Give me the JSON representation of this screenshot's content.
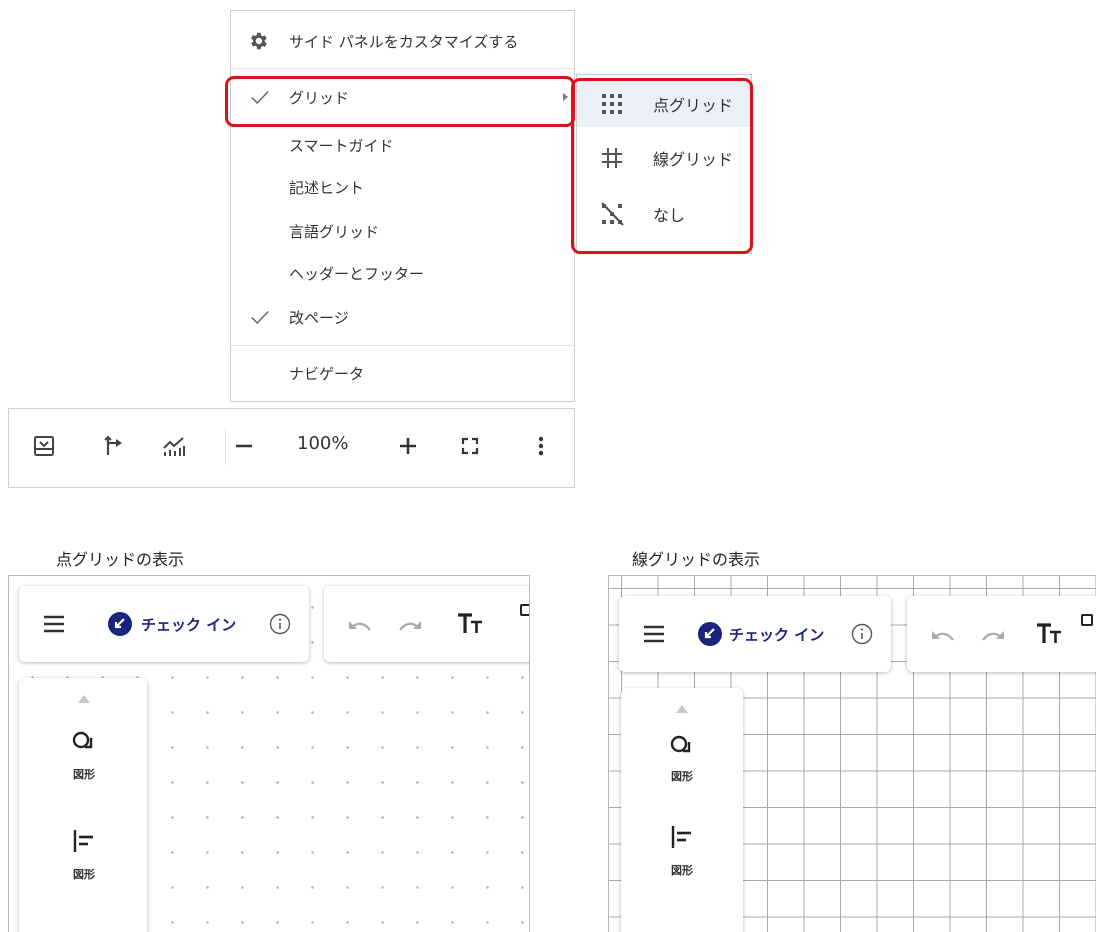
{
  "menu": {
    "customize_label": "サイド パネルをカスタマイズする",
    "items": [
      {
        "label": "グリッド",
        "checked": true,
        "has_submenu": true
      },
      {
        "label": "スマートガイド",
        "checked": false
      },
      {
        "label": "記述ヒント",
        "checked": false
      },
      {
        "label": "言語グリッド",
        "checked": false
      },
      {
        "label": "ヘッダーとフッター",
        "checked": false
      },
      {
        "label": "改ページ",
        "checked": true
      },
      {
        "label": "ナビゲータ",
        "checked": false
      }
    ]
  },
  "submenu": {
    "items": [
      {
        "label": "点グリッド",
        "icon": "dot-grid-icon",
        "selected": true
      },
      {
        "label": "線グリッド",
        "icon": "line-grid-icon",
        "selected": false
      },
      {
        "label": "なし",
        "icon": "grid-off-icon",
        "selected": false
      }
    ]
  },
  "toolbar": {
    "zoom": "100%",
    "icons": [
      "panel-icon",
      "connector-icon",
      "analytics-icon",
      "zoom-out-icon",
      "zoom-in-icon",
      "fullscreen-icon",
      "more-options-icon"
    ]
  },
  "captions": {
    "dot_grid": "点グリッドの表示",
    "line_grid": "線グリッドの表示"
  },
  "canvas": {
    "checkin_label": "チェック イン",
    "shapes_label_1": "図形",
    "shapes_label_2": "図形"
  },
  "colors": {
    "highlight": "#e0101a",
    "checkin_blue": "#1a237e",
    "active_item": "#eceef8"
  }
}
